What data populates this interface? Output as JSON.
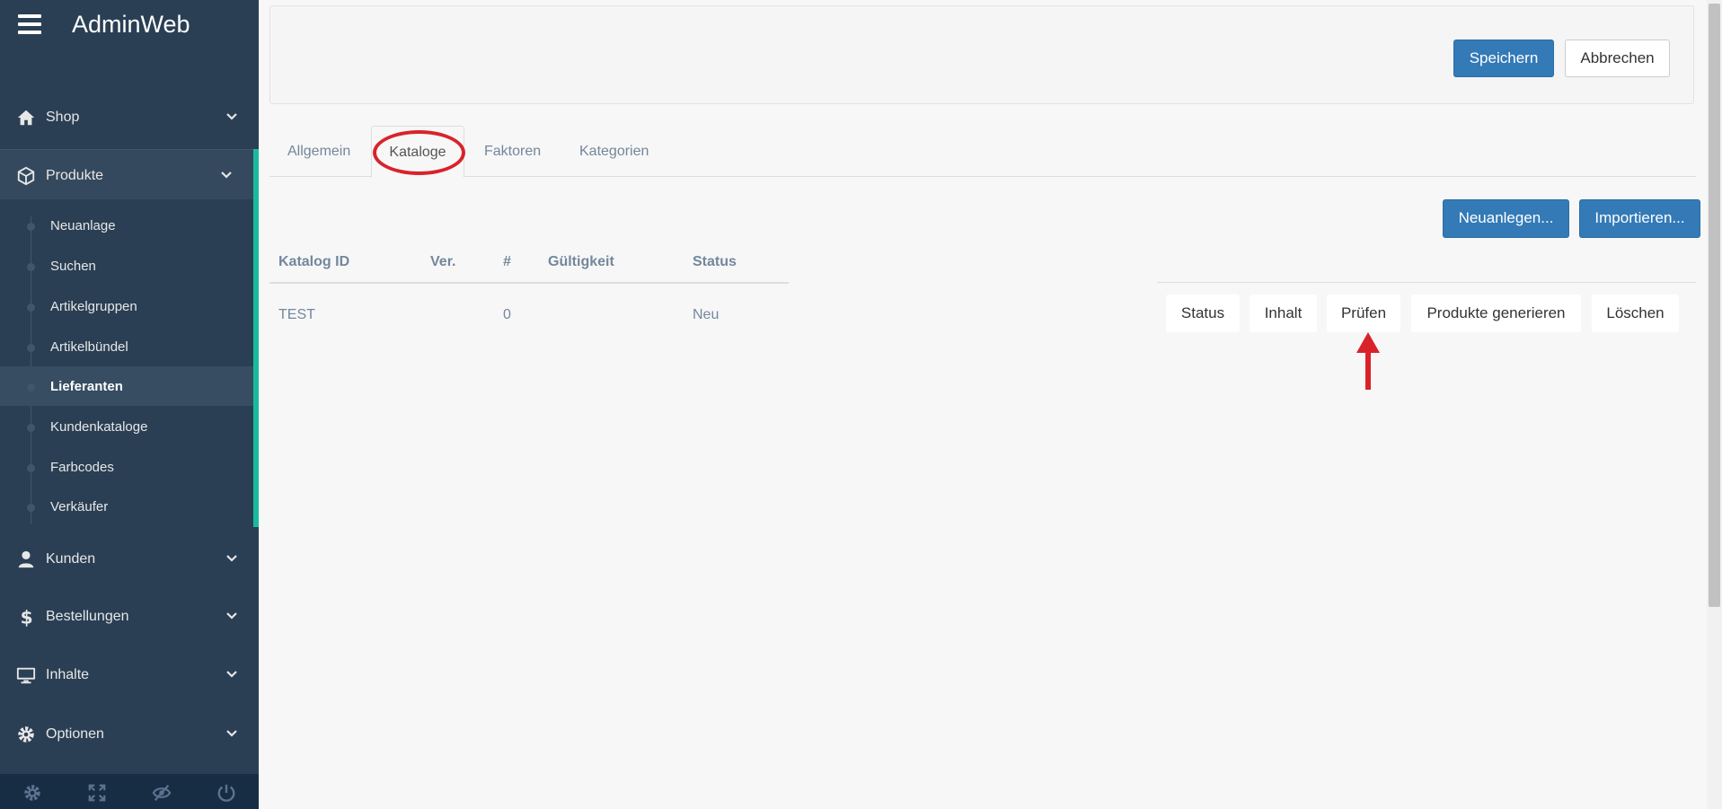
{
  "app": {
    "title": "AdminWeb"
  },
  "sidebar": {
    "sections": [
      {
        "label": "Shop",
        "icon": "home-icon"
      },
      {
        "label": "Produkte",
        "icon": "cube-icon"
      },
      {
        "label": "Kunden",
        "icon": "user-icon"
      },
      {
        "label": "Bestellungen",
        "icon": "dollar-icon"
      },
      {
        "label": "Inhalte",
        "icon": "monitor-icon"
      },
      {
        "label": "Optionen",
        "icon": "gear-icon"
      }
    ],
    "submenu": [
      {
        "label": "Neuanlage"
      },
      {
        "label": "Suchen"
      },
      {
        "label": "Artikelgruppen"
      },
      {
        "label": "Artikelbündel"
      },
      {
        "label": "Lieferanten",
        "active": true
      },
      {
        "label": "Kundenkataloge"
      },
      {
        "label": "Farbcodes"
      },
      {
        "label": "Verkäufer"
      }
    ],
    "footer_icons": [
      "settings-icon",
      "fullscreen-icon",
      "eye-slash-icon",
      "power-icon"
    ]
  },
  "toolbar": {
    "save_label": "Speichern",
    "cancel_label": "Abbrechen"
  },
  "tabs": [
    {
      "label": "Allgemein"
    },
    {
      "label": "Kataloge",
      "active": true
    },
    {
      "label": "Faktoren"
    },
    {
      "label": "Kategorien"
    }
  ],
  "actions": {
    "new_label": "Neuanlegen...",
    "import_label": "Importieren..."
  },
  "table": {
    "headers": [
      "Katalog ID",
      "Ver.",
      "#",
      "Gültigkeit",
      "Status"
    ],
    "rows": [
      {
        "katalog_id": "TEST",
        "ver": "",
        "count": "0",
        "gueltigkeit": "",
        "status": "Neu"
      }
    ]
  },
  "row_actions": [
    "Status",
    "Inhalt",
    "Prüfen",
    "Produkte generieren",
    "Löschen"
  ],
  "colors": {
    "sidebar_bg": "#2a3f54",
    "accent": "#1abb9c",
    "primary": "#337ab7",
    "annotation": "#d9232a"
  }
}
